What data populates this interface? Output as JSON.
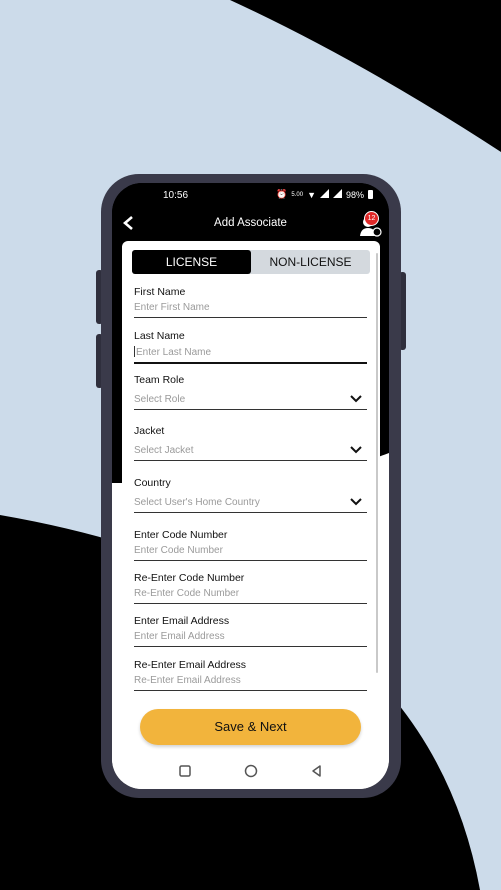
{
  "status": {
    "time": "10:56",
    "speed": "5.00",
    "battery": "98%"
  },
  "appbar": {
    "title": "Add Associate",
    "back_icon": "chevron-left-icon",
    "notifications": "12"
  },
  "tabs": [
    {
      "label": "LICENSE",
      "active": true
    },
    {
      "label": "NON-LICENSE",
      "active": false
    }
  ],
  "fields": [
    {
      "label": "First Name",
      "placeholder": "Enter First Name"
    },
    {
      "label": "Last Name",
      "placeholder": "Enter Last Name"
    },
    {
      "label": "Team Role",
      "placeholder": "Select Role"
    },
    {
      "label": "Jacket",
      "placeholder": "Select Jacket"
    },
    {
      "label": "Country",
      "placeholder": "Select User's Home Country"
    },
    {
      "label": "Enter Code Number",
      "placeholder": "Enter Code Number"
    },
    {
      "label": "Re-Enter Code Number",
      "placeholder": "Re-Enter Code Number"
    },
    {
      "label": "Enter Email Address",
      "placeholder": "Enter Email Address"
    },
    {
      "label": "Re-Enter Email Address",
      "placeholder": "Re-Enter Email Address"
    }
  ],
  "footer": {
    "save_label": "Save & Next"
  },
  "colors": {
    "accent": "#f2b43c",
    "background": "#ccdbea",
    "phone": "#3a3a4a"
  }
}
